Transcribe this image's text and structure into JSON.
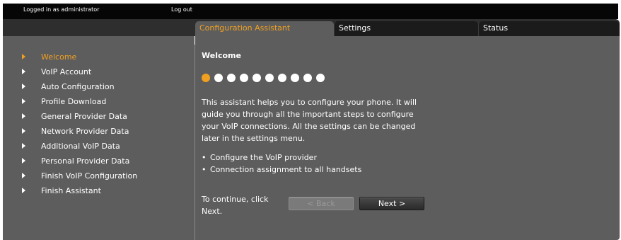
{
  "topbar": {
    "login_text": "Logged in as administrator",
    "logout_label": "Log out"
  },
  "tabs": [
    {
      "label": "Configuration Assistant",
      "active": true
    },
    {
      "label": "Settings",
      "active": false
    },
    {
      "label": "Status",
      "active": false
    }
  ],
  "sidebar": {
    "items": [
      {
        "label": "Welcome",
        "active": true
      },
      {
        "label": "VoIP Account"
      },
      {
        "label": "Auto Configuration"
      },
      {
        "label": "Profile Download"
      },
      {
        "label": "General Provider Data"
      },
      {
        "label": "Network Provider Data"
      },
      {
        "label": "Additional VoIP Data"
      },
      {
        "label": "Personal Provider Data"
      },
      {
        "label": "Finish VoIP Configuration"
      },
      {
        "label": "Finish Assistant"
      }
    ]
  },
  "main": {
    "heading": "Welcome",
    "progress": {
      "total_steps": 10,
      "current_step": 1
    },
    "intro": "This assistant helps you to configure your phone. It will guide you through all the important steps to configure your VoIP connections. All the settings can be changed later in the settings menu.",
    "bullets": [
      "Configure the VoIP provider",
      "Connection assignment to all handsets"
    ],
    "continue_line1": "To continue, click",
    "continue_line2": "Next.",
    "back_label": "< Back",
    "next_label": "Next >"
  },
  "colors": {
    "accent": "#f0a020",
    "panel": "#5d5d5d",
    "topbar": "#060606",
    "tabbar": "#2e2e2e"
  }
}
